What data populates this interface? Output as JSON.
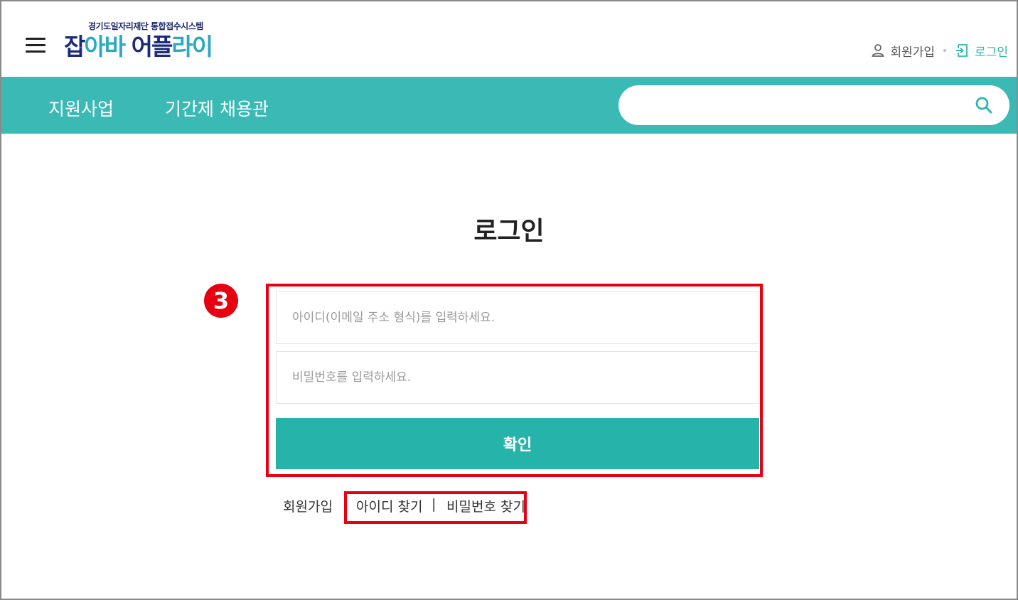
{
  "header": {
    "logo_sub": "경기도일자리재단 통합접수시스템",
    "logo_main_a": "잡",
    "logo_main_b": "아바",
    "logo_main_c": " 어",
    "logo_main_d": "플",
    "logo_main_e": "라이",
    "join_label": "회원가입",
    "login_label": "로그인"
  },
  "nav": {
    "items": [
      {
        "label": "지원사업"
      },
      {
        "label": "기간제 채용관"
      }
    ],
    "search": {
      "placeholder": "",
      "value": ""
    }
  },
  "main": {
    "title": "로그인",
    "step_badge": "3",
    "id_placeholder": "아이디(이메일 주소 형식)를 입력하세요.",
    "pw_placeholder": "비밀번호를 입력하세요.",
    "confirm_label": "확인",
    "links": {
      "join": "회원가입",
      "find_id": "아이디 찾기",
      "separator": "|",
      "find_pw": "비밀번호 찾기"
    }
  },
  "colors": {
    "accent": "#3bb9b4",
    "button": "#26b3a9",
    "highlight": "#e60012",
    "logo_dark": "#1b2b7a",
    "logo_light": "#2aa8c4"
  },
  "icons": {
    "menu": "hamburger-icon",
    "user": "user-icon",
    "login": "login-icon",
    "search": "search-icon"
  }
}
